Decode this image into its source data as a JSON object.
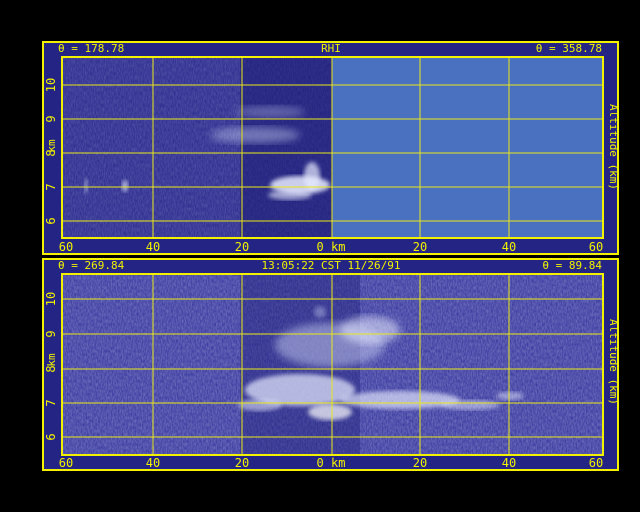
{
  "display": {
    "top_panel": {
      "left_angle": "θ = 178.78",
      "center_title": "RHI",
      "right_angle": "θ = 358.78"
    },
    "bottom_panel": {
      "left_angle": "θ = 269.84",
      "center_title": "13:05:22 CST 11/26/91",
      "right_angle": "θ = 89.84"
    },
    "axes": {
      "x_ticks": [
        "60",
        "40",
        "20",
        "0 km",
        "20",
        "40",
        "60"
      ],
      "y_ticks": [
        "6",
        "7",
        "8",
        "9",
        "10"
      ],
      "y_label_left": "km",
      "y_label_right": "Altitude (km)"
    },
    "colors": {
      "background": "#000000",
      "panel_fill": "#242484",
      "no_data_fill": "#4a70c0",
      "frame_and_text": "#f2f200",
      "echo": "#e8ecff"
    }
  }
}
